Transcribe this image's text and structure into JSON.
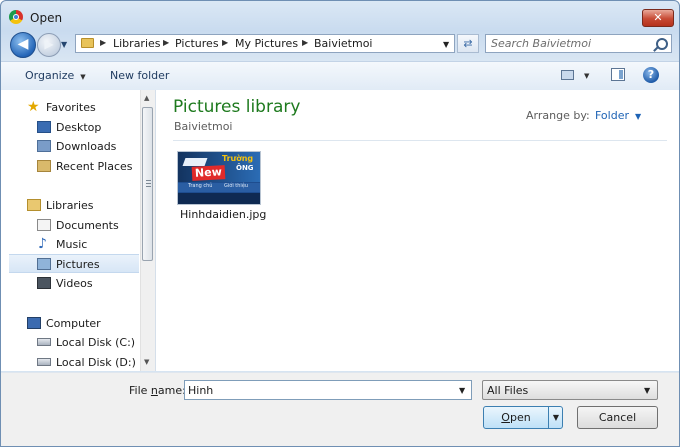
{
  "window": {
    "title": "Open",
    "close_label": "✕"
  },
  "nav": {
    "back_glyph": "◀",
    "forward_glyph": "▶",
    "breadcrumbs": [
      "Libraries",
      "Pictures",
      "My Pictures",
      "Baivietmoi"
    ],
    "search_placeholder": "Search Baivietmoi"
  },
  "toolbar": {
    "organize_label": "Organize",
    "new_folder_label": "New folder",
    "help_label": "?"
  },
  "sidebar": {
    "favorites": {
      "label": "Favorites",
      "items": [
        "Desktop",
        "Downloads",
        "Recent Places"
      ]
    },
    "libraries": {
      "label": "Libraries",
      "items": [
        "Documents",
        "Music",
        "Pictures",
        "Videos"
      ],
      "selected": "Pictures"
    },
    "computer": {
      "label": "Computer",
      "items": [
        "Local Disk (C:)",
        "Local Disk (D:)"
      ]
    }
  },
  "main": {
    "library_title": "Pictures library",
    "library_subtitle": "Baivietmoi",
    "arrange_label": "Arrange by:",
    "arrange_value": "Folder",
    "files": [
      {
        "name": "Hinhdaidien.jpg",
        "thumbnail_text": {
          "badge": "New",
          "brand_top": "Trường",
          "brand_side": "ÔNG",
          "menu_left": "Trang chủ",
          "menu_right": "Giới thiệu"
        }
      }
    ]
  },
  "footer": {
    "file_name_label_prefix": "File ",
    "file_name_label_underlined": "n",
    "file_name_label_suffix": "ame:",
    "file_name_value": "Hinh",
    "file_type_value": "All Files",
    "open_label_underlined": "O",
    "open_label_rest": "pen",
    "cancel_label": "Cancel"
  },
  "colors": {
    "library_title": "#1e7a1e",
    "link_blue": "#1e63b5",
    "selection_bg": "#d7e6f6"
  }
}
